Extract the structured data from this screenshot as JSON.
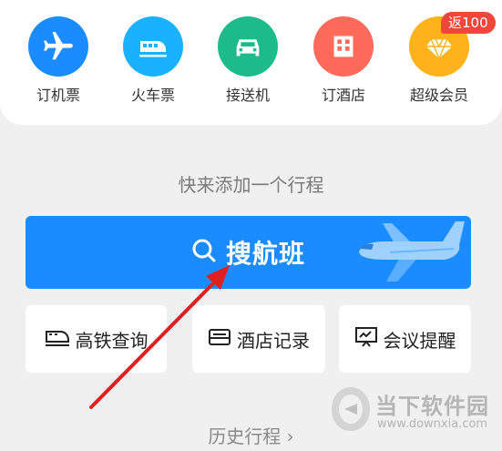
{
  "services": [
    {
      "label": "订机票",
      "icon": "airplane-icon",
      "color": "#1a8cff"
    },
    {
      "label": "火车票",
      "icon": "train-icon",
      "color": "#1ab2ff"
    },
    {
      "label": "接送机",
      "icon": "car-icon",
      "color": "#1dbb8c"
    },
    {
      "label": "订酒店",
      "icon": "hotel-icon",
      "color": "#ff6a5a"
    },
    {
      "label": "超级会员",
      "icon": "diamond-icon",
      "color": "#ffb21a"
    }
  ],
  "vip_badge": "返100",
  "empty_prompt": "快来添加一个行程",
  "search_flights_label": "搜航班",
  "tools": [
    {
      "label": "高铁查询",
      "icon": "train-icon"
    },
    {
      "label": "酒店记录",
      "icon": "bed-icon"
    },
    {
      "label": "会议提醒",
      "icon": "meeting-board-icon"
    }
  ],
  "history_link": "历史行程 ›",
  "watermark": {
    "title": "当下软件园",
    "url": "www.downxia.com"
  },
  "accent_color": "#1a8cff",
  "annotation_arrow_color": "#e02020"
}
